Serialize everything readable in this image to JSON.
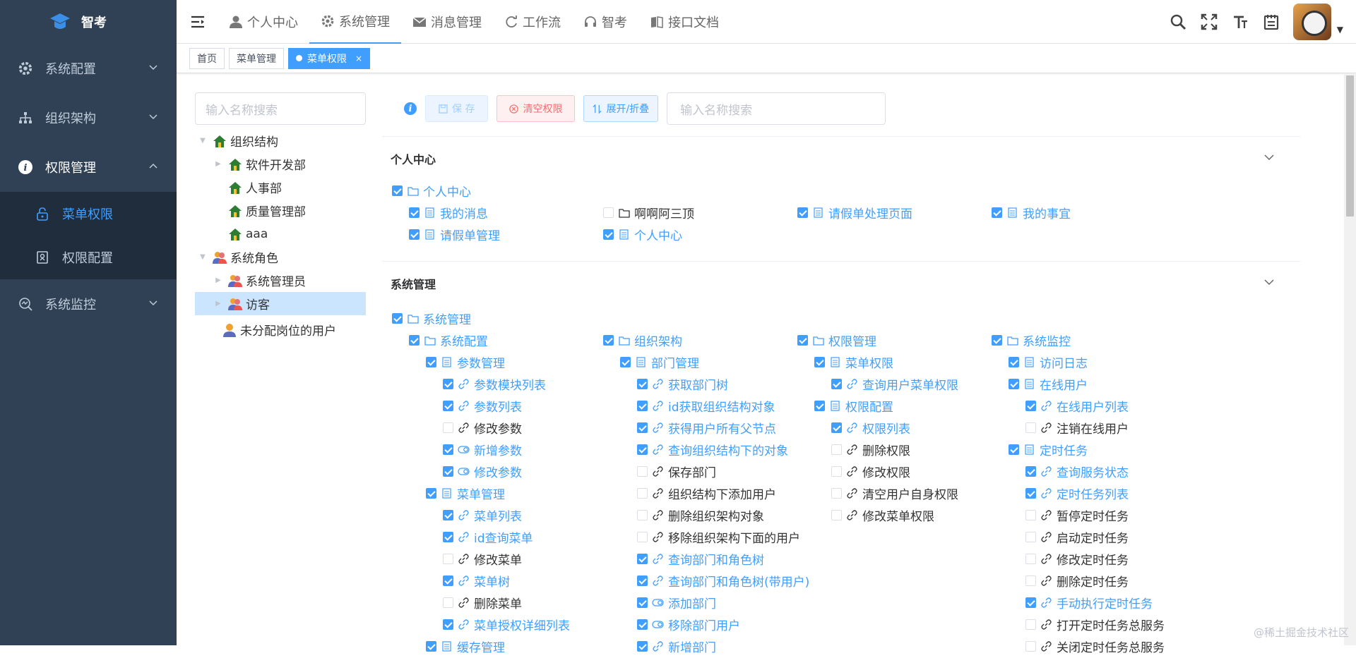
{
  "app": {
    "name": "智考"
  },
  "sidebar": {
    "items": [
      {
        "label": "系统配置"
      },
      {
        "label": "组织架构"
      },
      {
        "label": "权限管理"
      },
      {
        "label": "系统监控"
      }
    ],
    "submenu": [
      {
        "label": "菜单权限"
      },
      {
        "label": "权限配置"
      }
    ]
  },
  "topnav": [
    {
      "label": "个人中心"
    },
    {
      "label": "系统管理"
    },
    {
      "label": "消息管理"
    },
    {
      "label": "工作流"
    },
    {
      "label": "智考"
    },
    {
      "label": "接口文档"
    }
  ],
  "tags": [
    {
      "label": "首页"
    },
    {
      "label": "菜单管理"
    },
    {
      "label": "菜单权限",
      "close": "×"
    }
  ],
  "left_search": {
    "placeholder": "输入名称搜索"
  },
  "tree": [
    {
      "label": "组织结构"
    },
    {
      "label": "软件开发部"
    },
    {
      "label": "人事部"
    },
    {
      "label": "质量管理部"
    },
    {
      "label": "aaa"
    },
    {
      "label": "系统角色"
    },
    {
      "label": "系统管理员"
    },
    {
      "label": "访客"
    },
    {
      "label": "未分配岗位的用户"
    }
  ],
  "toolbar": {
    "save_label": "保 存",
    "clear_label": "清空权限",
    "toggle_label": "展开/折叠",
    "search_placeholder": "输入名称搜索"
  },
  "sections": {
    "personal": {
      "title": "个人中心"
    },
    "system": {
      "title": "系统管理"
    }
  },
  "perm_labels": {
    "p_root": "个人中心",
    "p1": "我的消息",
    "p2": "啊啊阿三顶",
    "p3": "请假单处理页面",
    "p4": "我的事宜",
    "p5": "请假单管理",
    "p6": "个人中心",
    "s_root": "系统管理",
    "c1": "系统配置",
    "c2": "组织架构",
    "c3": "权限管理",
    "c4": "系统监控",
    "a1": "参数管理",
    "a2": "部门管理",
    "a3": "菜单权限",
    "a4": "访问日志",
    "b1": "参数模块列表",
    "b2": "获取部门树",
    "b3": "查询用户菜单权限",
    "b4": "在线用户",
    "d1": "参数列表",
    "d2": "id获取组织结构对象",
    "d3": "权限配置",
    "d4": "在线用户列表",
    "e1": "修改参数",
    "e2": "获得用户所有父节点",
    "e3": "权限列表",
    "e4": "注销在线用户",
    "f1": "新增参数",
    "f2": "查询组织结构下的对象",
    "f3": "删除权限",
    "f4": "定时任务",
    "g1": "修改参数",
    "g2": "保存部门",
    "g3": "修改权限",
    "g4": "查询服务状态",
    "h1": "菜单管理",
    "h2": "组织结构下添加用户",
    "h3": "清空用户自身权限",
    "h4": "定时任务列表",
    "i1": "菜单列表",
    "i2": "删除组织架构对象",
    "i3": "修改菜单权限",
    "i4": "暂停定时任务",
    "j1": "id查询菜单",
    "j2": "移除组织架构下面的用户",
    "j4": "启动定时任务",
    "k1": "修改菜单",
    "k2": "查询部门和角色树",
    "k4": "修改定时任务",
    "l1": "菜单树",
    "l2": "查询部门和角色树(带用户)",
    "l4": "删除定时任务",
    "m1": "删除菜单",
    "m2": "添加部门",
    "m4": "手动执行定时任务",
    "n1": "菜单授权详细列表",
    "n2": "移除部门用户",
    "n4": "打开定时任务总服务",
    "o1": "缓存管理",
    "o2": "新增部门",
    "o4": "关闭定时任务总服务"
  },
  "watermark": "@稀土掘金技术社区",
  "colors": {
    "sidebar": "#304156",
    "accent": "#409eff",
    "submenu": "#1f2d3d"
  }
}
